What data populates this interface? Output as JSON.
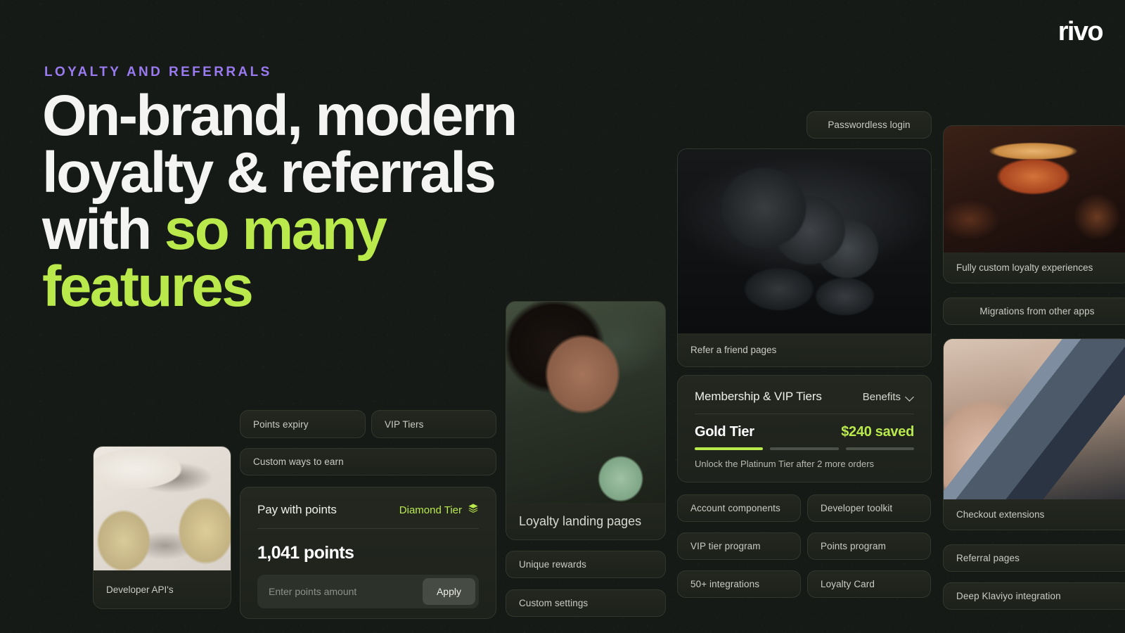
{
  "brand": {
    "logo_text": "rivo",
    "accent_lime": "#b9e94b",
    "accent_purple": "#9a7af0",
    "background": "#161a16"
  },
  "hero": {
    "eyebrow": "LOYALTY AND REFERRALS",
    "headline_plain_1": "On-brand, modern loyalty & referrals with ",
    "headline_accent": "so many features"
  },
  "cards": {
    "pay_with_points": {
      "title": "Pay with points",
      "tier_label": "Diamond Tier",
      "tier_icon": "layers-icon",
      "points_amount": "1,041 points",
      "input_placeholder": "Enter points amount",
      "input_value": "",
      "apply_label": "Apply"
    },
    "membership": {
      "title": "Membership & VIP Tiers",
      "benefits_label": "Benefits",
      "benefits_icon": "chevron-down-icon",
      "tier_name": "Gold Tier",
      "saved_amount": "$240 saved",
      "progress_segments": 3,
      "progress_filled": 1,
      "note": "Unlock the Platinum Tier after 2 more orders"
    }
  },
  "media": {
    "developer_api": {
      "caption": "Developer API's",
      "image": "photo-capsules"
    },
    "refer_a_friend": {
      "caption": "Refer a friend pages",
      "image": "photo-cookware-pans"
    },
    "loyalty_landing": {
      "caption": "Loyalty landing pages",
      "image": "photo-woman-skincare"
    },
    "fully_custom": {
      "caption": "Fully custom loyalty experiences",
      "image": "photo-cocktail"
    },
    "checkout_extensions": {
      "caption": "Checkout extensions",
      "image": "photo-hand-credit-card"
    }
  },
  "pills": {
    "passwordless_login": "Passwordless login",
    "points_expiry": "Points expiry",
    "vip_tiers": "VIP Tiers",
    "custom_ways_to_earn": "Custom ways to earn",
    "unique_rewards": "Unique rewards",
    "custom_settings": "Custom settings",
    "account_components": "Account components",
    "developer_toolkit": "Developer toolkit",
    "vip_tier_program": "VIP tier program",
    "points_program": "Points program",
    "fifty_plus_integrations": "50+ integrations",
    "loyalty_card": "Loyalty Card",
    "migrations": "Migrations from other apps",
    "referral_pages": "Referral pages",
    "deep_klaviyo": "Deep Klaviyo integration"
  }
}
